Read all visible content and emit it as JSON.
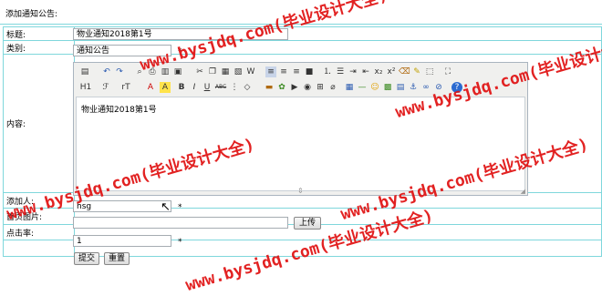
{
  "page": {
    "title": "添加通知公告:"
  },
  "form": {
    "title_label": "标题:",
    "title_value": "物业通知2018第1号",
    "category_label": "类别:",
    "category_value": "通知公告",
    "required_mark": "*",
    "content_label": "内容:",
    "content_value": "物业通知2018第1号",
    "author_label": "添加人:",
    "author_value": "hsg",
    "image_label": "首页图片:",
    "image_value": "",
    "upload_label": "上传",
    "clicks_label": "点击率:",
    "clicks_value": "1",
    "submit_label": "提交",
    "reset_label": "重置"
  },
  "toolbar": {
    "heading_label": "H1",
    "font_label": "ℱ",
    "size_label": "rT",
    "bold": "B",
    "italic": "I",
    "underline": "U",
    "strike": "ABC",
    "sup": "x²",
    "sub": "x₂"
  },
  "watermark": "www.bysjdq.com(毕业设计大全)",
  "colors": {
    "border": "#7fd7dc",
    "watermark": "#e01010",
    "editor_bg": "#f0f0ee"
  }
}
